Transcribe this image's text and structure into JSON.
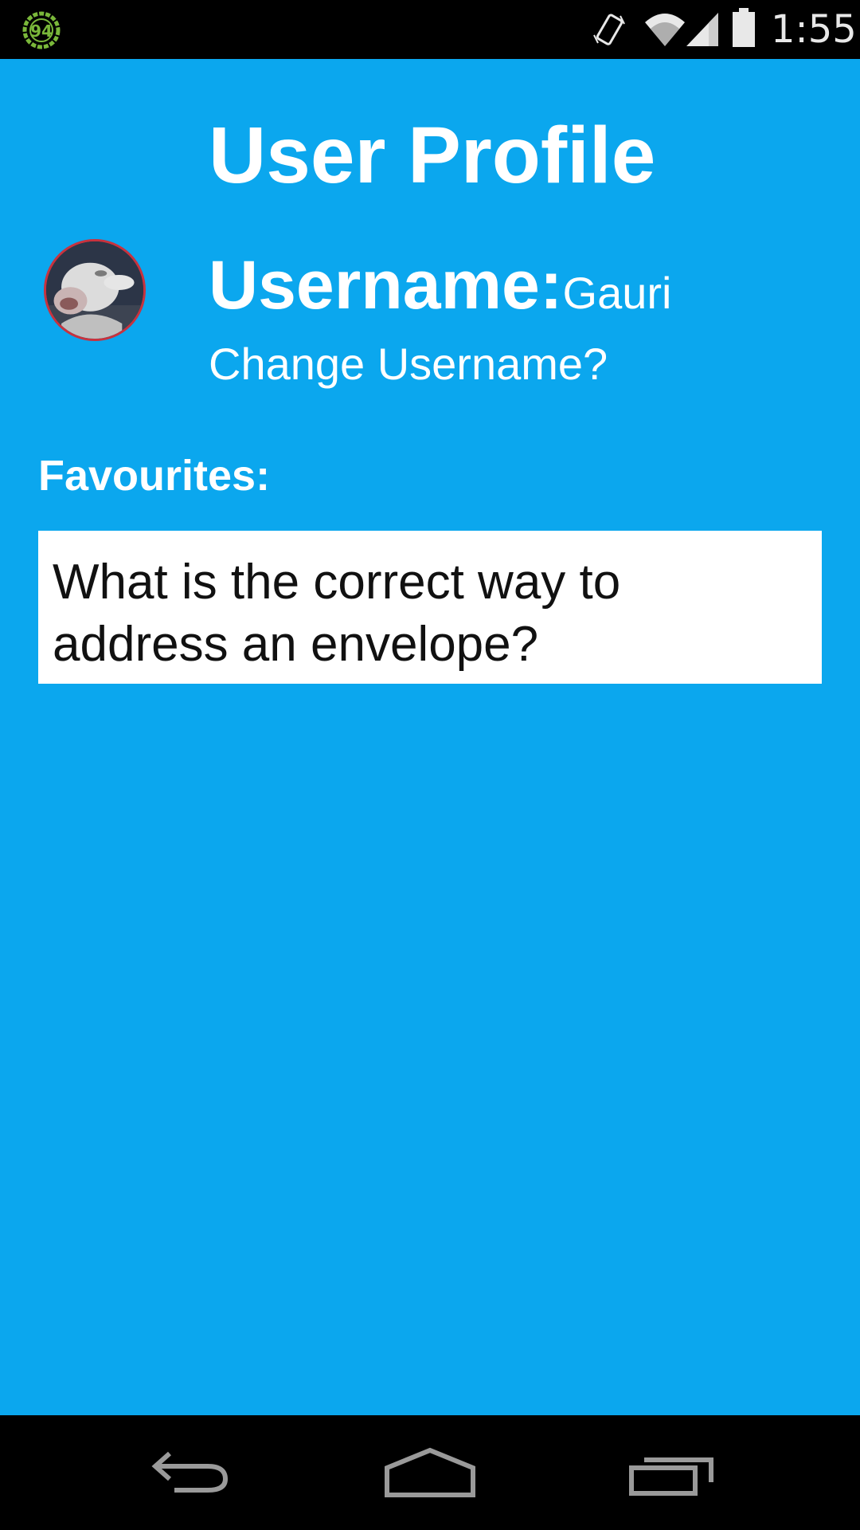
{
  "status_bar": {
    "notification_badge": "94",
    "time": "1:55",
    "icons": {
      "left": "circular-badge-icon",
      "vibrate": "vibrate-icon",
      "wifi": "wifi-icon",
      "signal": "signal-icon",
      "battery": "battery-icon"
    }
  },
  "profile": {
    "title": "User Profile",
    "username_label": "Username:",
    "username_value": "Gauri",
    "change_username_link": "Change Username?",
    "favourites_label": "Favourites:",
    "favourites": [
      "What is the correct way to address an envelope?"
    ]
  },
  "nav_bar": {
    "icons": [
      "back-icon",
      "home-icon",
      "recents-icon"
    ]
  },
  "colors": {
    "background": "#0ba7ee",
    "text_primary": "#ffffff",
    "list_item_bg": "#ffffff",
    "list_item_text": "#111111",
    "system_bars": "#000000",
    "avatar_border": "#c8323e",
    "badge_green": "#7ab83a"
  }
}
